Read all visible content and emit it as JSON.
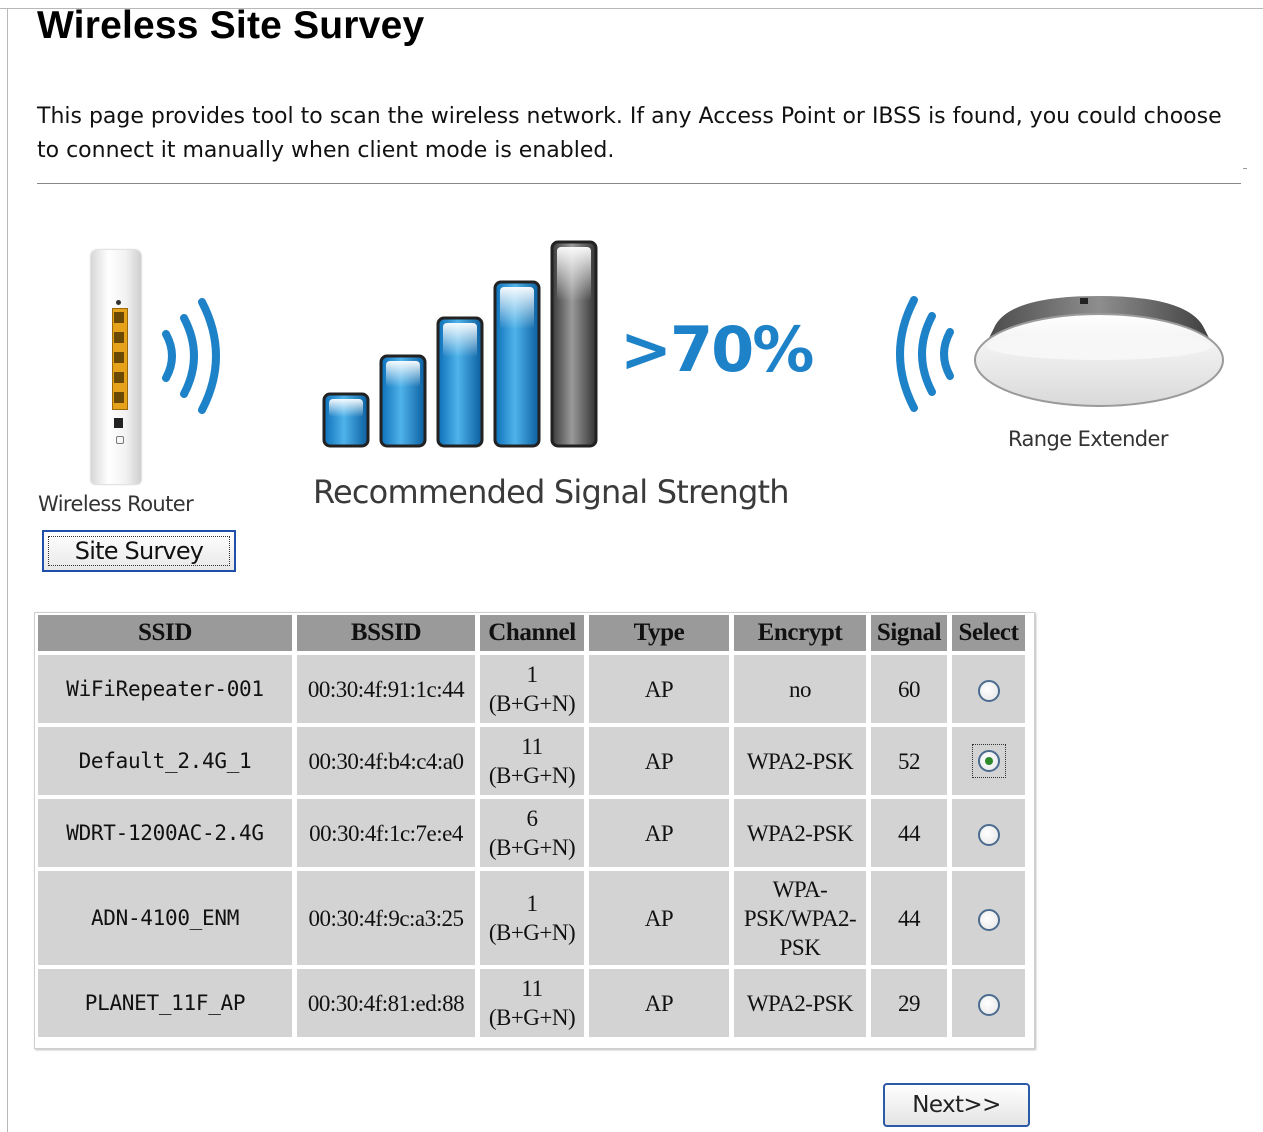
{
  "page": {
    "title": "Wireless Site Survey",
    "description": "This page provides tool to scan the wireless network. If any Access Point or IBSS is found, you could choose to connect it manually when client mode is enabled."
  },
  "banner": {
    "router_label": "Wireless Router",
    "extender_label": "Range Extender",
    "signal_percent": ">70%",
    "signal_label": "Recommended Signal Strength",
    "signal_level_fraction": 0.7,
    "accent_color": "#1e82c8",
    "icons": [
      "router-icon",
      "wifi-waves-icon",
      "signal-bars-icon",
      "range-extender-icon"
    ]
  },
  "buttons": {
    "site_survey": "Site Survey",
    "next": "Next>>"
  },
  "table": {
    "headers": [
      "SSID",
      "BSSID",
      "Channel",
      "Type",
      "Encrypt",
      "Signal",
      "Select"
    ],
    "rows": [
      {
        "ssid": "WiFiRepeater-001",
        "bssid": "00:30:4f:91:1c:44",
        "channel": "1",
        "band": "(B+G+N)",
        "type": "AP",
        "encrypt_lines": [
          "no"
        ],
        "signal": "60",
        "selected": false
      },
      {
        "ssid": "Default_2.4G_1",
        "bssid": "00:30:4f:b4:c4:a0",
        "channel": "11",
        "band": "(B+G+N)",
        "type": "AP",
        "encrypt_lines": [
          "WPA2-PSK"
        ],
        "signal": "52",
        "selected": true
      },
      {
        "ssid": "WDRT-1200AC-2.4G",
        "bssid": "00:30:4f:1c:7e:e4",
        "channel": "6",
        "band": "(B+G+N)",
        "type": "AP",
        "encrypt_lines": [
          "WPA2-PSK"
        ],
        "signal": "44",
        "selected": false
      },
      {
        "ssid": "ADN-4100_ENM",
        "bssid": "00:30:4f:9c:a3:25",
        "channel": "1",
        "band": "(B+G+N)",
        "type": "AP",
        "encrypt_lines": [
          "WPA-",
          "PSK/WPA2-",
          "PSK"
        ],
        "signal": "44",
        "selected": false
      },
      {
        "ssid": "PLANET_11F_AP",
        "bssid": "00:30:4f:81:ed:88",
        "channel": "11",
        "band": "(B+G+N)",
        "type": "AP",
        "encrypt_lines": [
          "WPA2-PSK"
        ],
        "signal": "29",
        "selected": false
      }
    ]
  }
}
